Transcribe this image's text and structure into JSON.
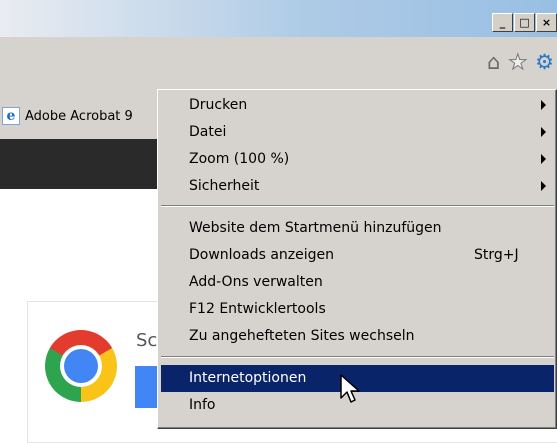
{
  "window": {
    "minimize": "_",
    "maximize": "□",
    "close": "×"
  },
  "commandbar": {
    "icons": [
      "home-icon",
      "favorites-star-icon",
      "tools-gear-icon"
    ]
  },
  "favorites_bar": {
    "item_label": "Adobe Acrobat 9"
  },
  "content": {
    "card_text": "Sc"
  },
  "menu": {
    "items": [
      {
        "label": "Drucken",
        "submenu": true
      },
      {
        "label": "Datei",
        "submenu": true
      },
      {
        "label": "Zoom (100 %)",
        "submenu": true
      },
      {
        "label": "Sicherheit",
        "submenu": true
      },
      {
        "label": "Website dem Startmenü hinzufügen"
      },
      {
        "label": "Downloads anzeigen",
        "shortcut": "Strg+J"
      },
      {
        "label": "Add-Ons verwalten"
      },
      {
        "label": "F12 Entwicklertools"
      },
      {
        "label": "Zu angehefteten Sites wechseln"
      },
      {
        "label": "Internetoptionen",
        "selected": true
      },
      {
        "label": "Info"
      }
    ]
  },
  "colors": {
    "menu_bg": "#d6d3ce",
    "selection": "#0a246a",
    "gear": "#2a78c8"
  }
}
